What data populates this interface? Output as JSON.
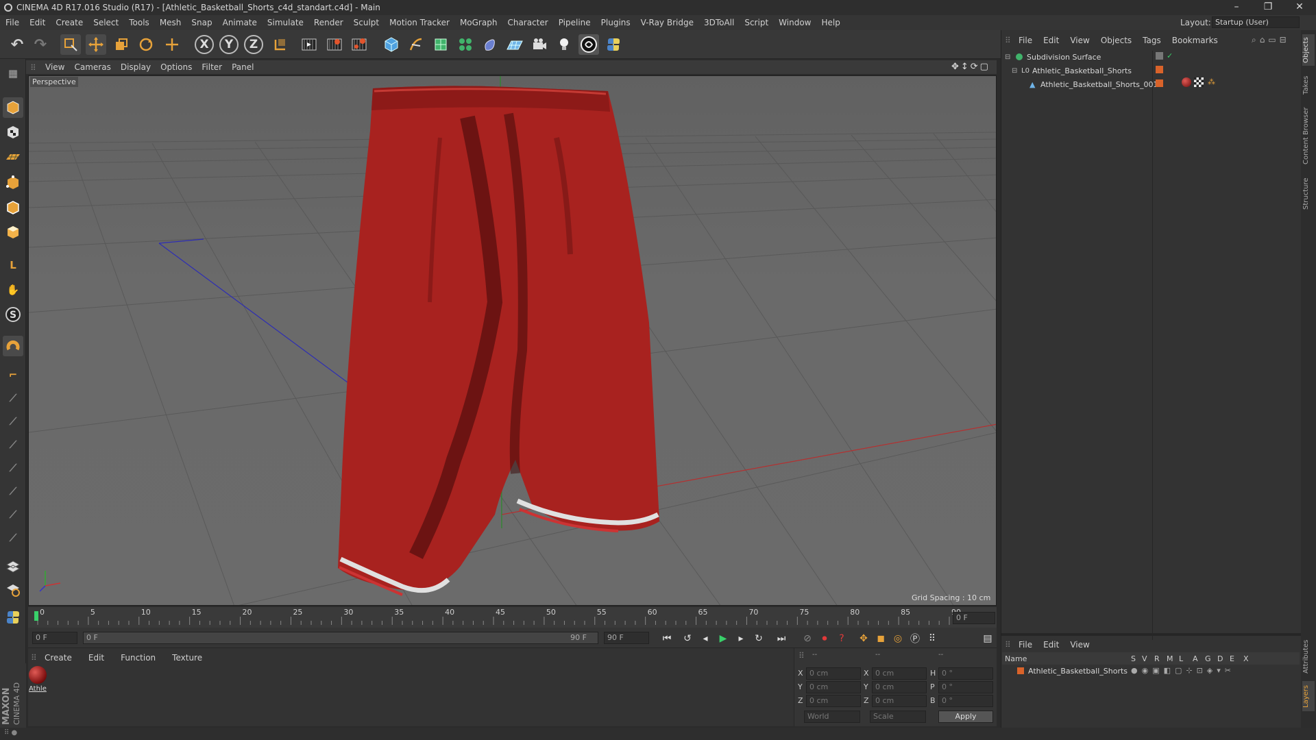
{
  "window": {
    "title": "CINEMA 4D R17.016 Studio (R17) - [Athletic_Basketball_Shorts_c4d_standart.c4d] - Main",
    "controls": [
      "–",
      "❐",
      "✕"
    ]
  },
  "menu": [
    "File",
    "Edit",
    "Create",
    "Select",
    "Tools",
    "Mesh",
    "Snap",
    "Animate",
    "Simulate",
    "Render",
    "Sculpt",
    "Motion Tracker",
    "MoGraph",
    "Character",
    "Pipeline",
    "Plugins",
    "V-Ray Bridge",
    "3DToAll",
    "Script",
    "Window",
    "Help"
  ],
  "layout": {
    "label": "Layout:",
    "value": "Startup (User)"
  },
  "toolbar": {
    "icons": [
      "undo-icon",
      "redo-icon",
      "select-icon",
      "move-icon",
      "scale-icon",
      "rotate-icon",
      "live-select-icon",
      "x-axis-icon",
      "y-axis-icon",
      "z-axis-icon",
      "coord-system-icon",
      "render-view-icon",
      "render-picture-viewer-icon",
      "edit-render-settings-icon",
      "cube-icon",
      "pen-icon",
      "subdivision-icon",
      "cloner-icon",
      "deformer-icon",
      "floor-icon",
      "camera-icon",
      "light-icon",
      "sketch-icon",
      "python-icon"
    ],
    "axes": [
      "X",
      "Y",
      "Z"
    ]
  },
  "viewport": {
    "menu": [
      "View",
      "Cameras",
      "Display",
      "Options",
      "Filter",
      "Panel"
    ],
    "camera": "Perspective",
    "grid_spacing": "Grid Spacing : 10 cm"
  },
  "timeline": {
    "ticks": [
      "0",
      "5",
      "10",
      "15",
      "20",
      "25",
      "30",
      "35",
      "40",
      "45",
      "50",
      "55",
      "60",
      "65",
      "70",
      "75",
      "80",
      "85",
      "90"
    ],
    "current_frame": "0 F",
    "start_field": "0 F",
    "range_start": "0 F",
    "range_end": "90 F",
    "end_field": "90 F"
  },
  "material_manager": {
    "menu": [
      "Create",
      "Edit",
      "Function",
      "Texture"
    ],
    "materials": [
      {
        "name": "Athle"
      }
    ]
  },
  "coordinates": {
    "header": [
      "--",
      "--",
      "--"
    ],
    "rows": [
      {
        "a": "X",
        "av": "0 cm",
        "b": "X",
        "bv": "0 cm",
        "c": "H",
        "cv": "0 °"
      },
      {
        "a": "Y",
        "av": "0 cm",
        "b": "Y",
        "bv": "0 cm",
        "c": "P",
        "cv": "0 °"
      },
      {
        "a": "Z",
        "av": "0 cm",
        "b": "Z",
        "bv": "0 cm",
        "c": "B",
        "cv": "0 °"
      }
    ],
    "mode": "World",
    "scale": "Scale",
    "apply": "Apply"
  },
  "object_manager": {
    "menu": [
      "File",
      "Edit",
      "View",
      "Objects",
      "Tags",
      "Bookmarks"
    ],
    "objects": [
      {
        "name": "Subdivision Surface",
        "level": 0
      },
      {
        "name": "Athletic_Basketball_Shorts",
        "level": 1
      },
      {
        "name": "Athletic_Basketball_Shorts_001",
        "level": 2
      }
    ]
  },
  "layer_manager": {
    "menu": [
      "File",
      "Edit",
      "View"
    ],
    "columns": [
      "Name",
      "S",
      "V",
      "R",
      "M",
      "L",
      "A",
      "G",
      "D",
      "E",
      "X"
    ],
    "layers": [
      {
        "name": "Athletic_Basketball_Shorts",
        "color": "#d9632a"
      }
    ]
  },
  "side_tabs": [
    "Objects",
    "Takes",
    "Content Browser",
    "Structure",
    "Attributes",
    "Layers"
  ],
  "brand": {
    "maxon": "MAXON",
    "c4d": "CINEMA 4D"
  },
  "colors": {
    "accent": "#e7a23a",
    "shorts": "#a8221f",
    "selection_orange": "#d9632a"
  }
}
